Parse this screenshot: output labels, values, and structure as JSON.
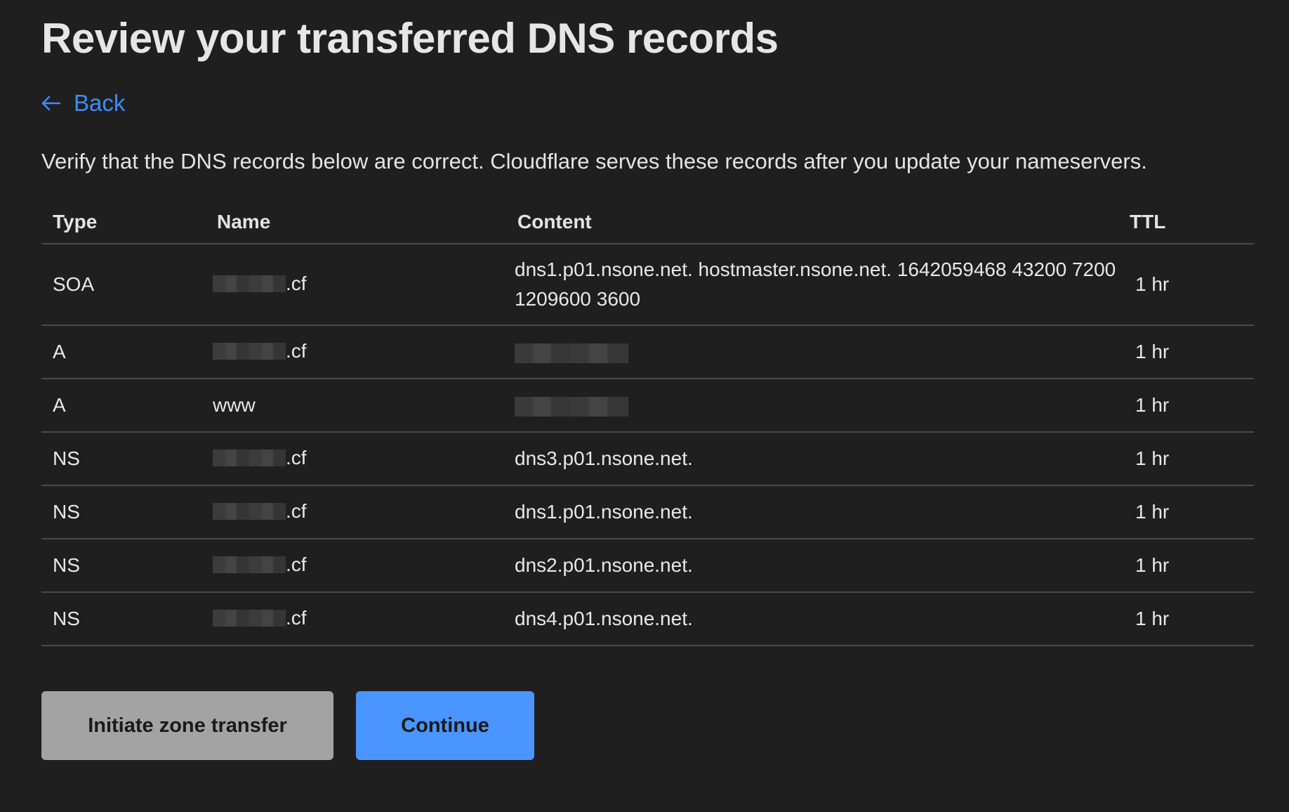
{
  "page": {
    "title": "Review your transferred DNS records",
    "back_label": "Back",
    "description": "Verify that the DNS records below are correct. Cloudflare serves these records after you update your nameservers."
  },
  "table": {
    "headers": {
      "type": "Type",
      "name": "Name",
      "content": "Content",
      "ttl": "TTL"
    },
    "rows": [
      {
        "type": "SOA",
        "name_suffix": ".cf",
        "name_redacted": true,
        "content": "dns1.p01.nsone.net. hostmaster.nsone.net. 1642059468 43200 7200 1209600 3600",
        "content_redacted": false,
        "ttl": "1 hr"
      },
      {
        "type": "A",
        "name_suffix": ".cf",
        "name_redacted": true,
        "content": "",
        "content_redacted": true,
        "ttl": "1 hr"
      },
      {
        "type": "A",
        "name_suffix": "www",
        "name_redacted": false,
        "content": "",
        "content_redacted": true,
        "ttl": "1 hr"
      },
      {
        "type": "NS",
        "name_suffix": ".cf",
        "name_redacted": true,
        "content": "dns3.p01.nsone.net.",
        "content_redacted": false,
        "ttl": "1 hr"
      },
      {
        "type": "NS",
        "name_suffix": ".cf",
        "name_redacted": true,
        "content": "dns1.p01.nsone.net.",
        "content_redacted": false,
        "ttl": "1 hr"
      },
      {
        "type": "NS",
        "name_suffix": ".cf",
        "name_redacted": true,
        "content": "dns2.p01.nsone.net.",
        "content_redacted": false,
        "ttl": "1 hr"
      },
      {
        "type": "NS",
        "name_suffix": ".cf",
        "name_redacted": true,
        "content": "dns4.p01.nsone.net.",
        "content_redacted": false,
        "ttl": "1 hr"
      }
    ]
  },
  "buttons": {
    "initiate_label": "Initiate zone transfer",
    "continue_label": "Continue"
  },
  "colors": {
    "background": "#1f1f1f",
    "link": "#3d8bff",
    "primary_button": "#4a95ff",
    "secondary_button": "#a3a3a3"
  },
  "icons": {
    "back": "arrow-left-icon"
  }
}
